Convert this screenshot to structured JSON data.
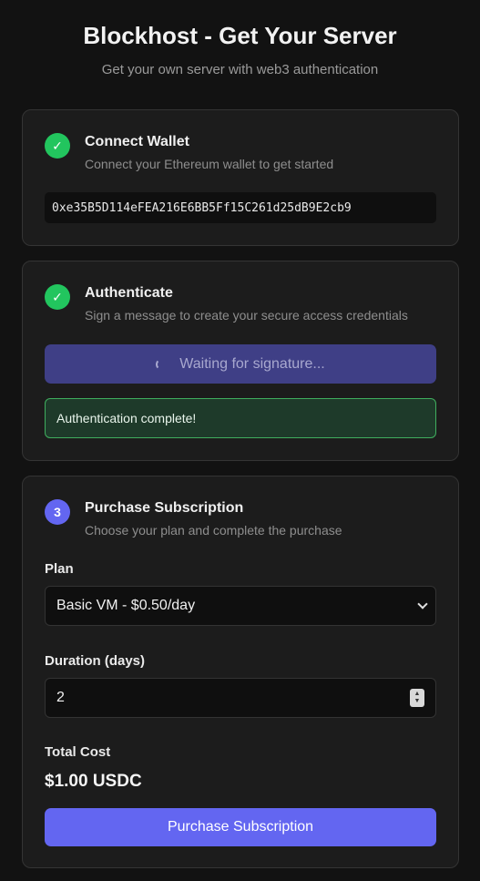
{
  "header": {
    "title": "Blockhost - Get Your Server",
    "subtitle": "Get your own server with web3 authentication"
  },
  "steps": [
    {
      "status": "done",
      "icon": "check-icon",
      "marker": "✓",
      "title": "Connect Wallet",
      "description": "Connect your Ethereum wallet to get started",
      "wallet_address": "0xe35B5D114eFEA216E6BB5Ff15C261d25dB9E2cb9"
    },
    {
      "status": "done",
      "icon": "check-icon",
      "marker": "✓",
      "title": "Authenticate",
      "description": "Sign a message to create your secure access credentials",
      "button_label": "Waiting for signature...",
      "success_message": "Authentication complete!"
    },
    {
      "status": "active",
      "marker": "3",
      "title": "Purchase Subscription",
      "description": "Choose your plan and complete the purchase",
      "plan_label": "Plan",
      "plan_selected": "Basic VM - $0.50/day",
      "duration_label": "Duration (days)",
      "duration_value": "2",
      "total_label": "Total Cost",
      "total_value": "$1.00 USDC",
      "button_label": "Purchase Subscription"
    }
  ],
  "colors": {
    "background": "#121212",
    "card": "#1c1c1c",
    "success": "#22c55e",
    "accent": "#6366f1",
    "accent_disabled": "#3f3f86"
  }
}
